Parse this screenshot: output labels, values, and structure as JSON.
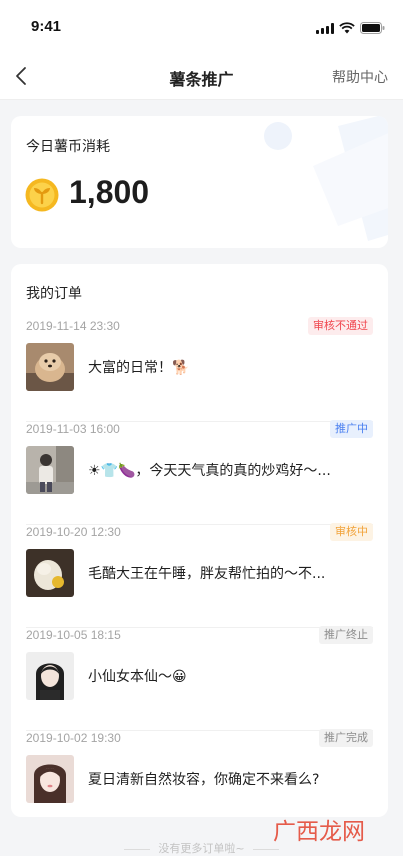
{
  "status_bar": {
    "time": "9:41"
  },
  "nav": {
    "title": "薯条推广",
    "help_label": "帮助中心"
  },
  "coins": {
    "title": "今日薯币消耗",
    "amount": "1,800"
  },
  "orders": {
    "title": "我的订单",
    "items": [
      {
        "date": "2019-11-14  23:30",
        "status": "审核不通过",
        "text": "大富的日常！🐕"
      },
      {
        "date": "2019-11-03  16:00",
        "status": "推广中",
        "text": "☀👕🍆，今天天气真的真的炒鸡好～..."
      },
      {
        "date": "2019-10-20  12:30",
        "status": "审核中",
        "text": "毛酷大王在午睡，胖友帮忙拍的～不..."
      },
      {
        "date": "2019-10-05  18:15",
        "status": "推广终止",
        "text": "小仙女本仙～😀"
      },
      {
        "date": "2019-10-02  19:30",
        "status": "推广完成",
        "text": "夏日清新自然妆容，你确定不来看么?"
      }
    ]
  },
  "footer": {
    "end_text": "没有更多订单啦~"
  },
  "watermark": {
    "text": "广西龙网"
  },
  "colors": {
    "badge_rejected": "#f0464e",
    "badge_promoting": "#4a7ff0",
    "badge_reviewing": "#f2a33a",
    "badge_neutral": "#8c8c8c"
  }
}
